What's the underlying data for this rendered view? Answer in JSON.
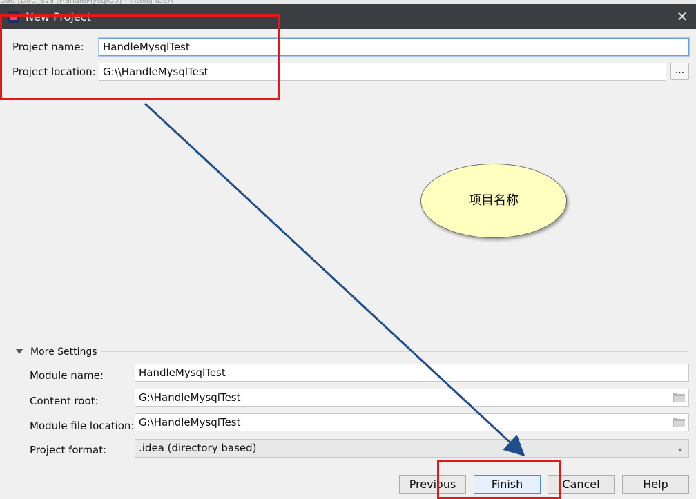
{
  "window": {
    "background_title": "Dao [Dao.java [HandleMysqlOp] - IntelliJ IDEA",
    "title": "New Project",
    "close_symbol": "✕"
  },
  "project": {
    "name_label": "Project name:",
    "name_value": "HandleMysqlTest",
    "location_label": "Project location:",
    "location_value": "G:\\\\HandleMysqlTest",
    "browse_label": "..."
  },
  "annotation": {
    "callout_text": "项目名称",
    "highlight_color": "#e01a1a",
    "arrow_color": "#1f4e8c",
    "callout_fill": "#ffffc0"
  },
  "more_settings": {
    "label": "More Settings",
    "module_name_label": "Module name:",
    "module_name_value": "HandleMysqlTest",
    "content_root_label": "Content root:",
    "content_root_value": "G:\\HandleMysqlTest",
    "module_file_label": "Module file location:",
    "module_file_value": "G:\\HandleMysqlTest",
    "format_label": "Project format:",
    "format_value": ".idea (directory based)"
  },
  "buttons": {
    "previous": "Previous",
    "finish": "Finish",
    "cancel": "Cancel",
    "help": "Help"
  }
}
